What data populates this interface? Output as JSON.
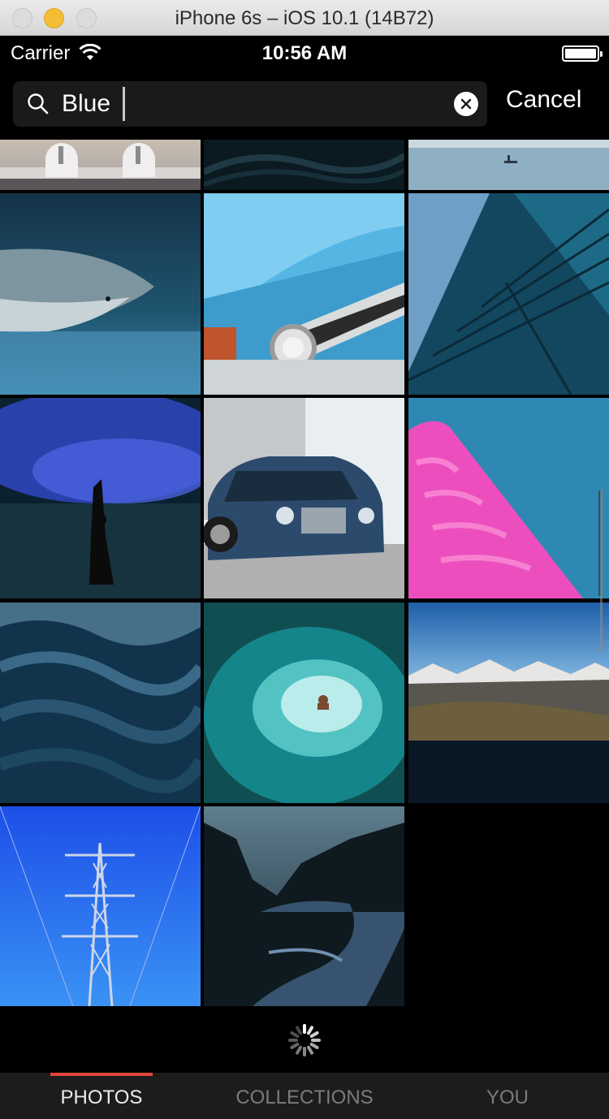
{
  "window": {
    "title": "iPhone 6s – iOS 10.1 (14B72)"
  },
  "status_bar": {
    "carrier": "Carrier",
    "time": "10:56 AM",
    "battery_level": 1.0
  },
  "search": {
    "value": "Blue",
    "cancel_label": "Cancel"
  },
  "photos": [
    {
      "subject": "observatory-domes"
    },
    {
      "subject": "dark-feathers"
    },
    {
      "subject": "sea-paddleboarder"
    },
    {
      "subject": "shark"
    },
    {
      "subject": "blue-vintage-truck"
    },
    {
      "subject": "glass-building"
    },
    {
      "subject": "blue-smoke-flare"
    },
    {
      "subject": "blue-bentley-car"
    },
    {
      "subject": "pink-air-mattress"
    },
    {
      "subject": "ocean-waves"
    },
    {
      "subject": "swimmer-in-turquoise-water"
    },
    {
      "subject": "mountain-range"
    },
    {
      "subject": "power-pylon"
    },
    {
      "subject": "mountain-river-night"
    }
  ],
  "tabs": [
    {
      "label": "PHOTOS",
      "active": true
    },
    {
      "label": "COLLECTIONS",
      "active": false
    },
    {
      "label": "YOU",
      "active": false
    }
  ],
  "colors": {
    "accent": "#e0463c",
    "background": "#000000"
  }
}
